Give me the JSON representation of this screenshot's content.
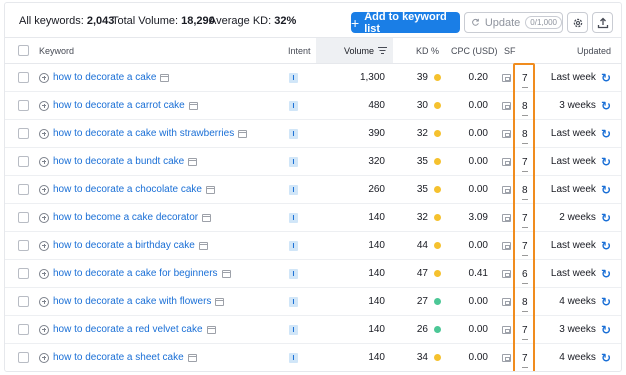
{
  "summary": {
    "all_keywords_label": "All keywords:",
    "all_keywords_value": "2,043",
    "total_volume_label": "Total Volume:",
    "total_volume_value": "18,290",
    "avg_kd_label": "Average KD:",
    "avg_kd_value": "32%"
  },
  "toolbar": {
    "add_label": "Add to keyword list",
    "update_label": "Update",
    "update_count": "0/1,000",
    "settings_icon": "gear-icon",
    "export_icon": "export-icon"
  },
  "columns": {
    "keyword": "Keyword",
    "intent": "Intent",
    "volume": "Volume",
    "kd": "KD %",
    "cpc": "CPC (USD)",
    "sf": "SF",
    "updated": "Updated"
  },
  "colors": {
    "accent": "#1a7ee6",
    "link": "#1a6fd6",
    "kd_yellow": "#f5c12e",
    "kd_green": "#4cc796",
    "highlight": "#f08c1e"
  },
  "rows": [
    {
      "keyword": "how to decorate a cake",
      "intent": "I",
      "volume": "1,300",
      "kd": "39",
      "kd_color": "#f5c12e",
      "cpc": "0.20",
      "sf": "7",
      "updated": "Last week"
    },
    {
      "keyword": "how to decorate a carrot cake",
      "intent": "I",
      "volume": "480",
      "kd": "30",
      "kd_color": "#f5c12e",
      "cpc": "0.00",
      "sf": "8",
      "updated": "3 weeks"
    },
    {
      "keyword": "how to decorate a cake with strawberries",
      "intent": "I",
      "volume": "390",
      "kd": "32",
      "kd_color": "#f5c12e",
      "cpc": "0.00",
      "sf": "8",
      "updated": "Last week"
    },
    {
      "keyword": "how to decorate a bundt cake",
      "intent": "I",
      "volume": "320",
      "kd": "35",
      "kd_color": "#f5c12e",
      "cpc": "0.00",
      "sf": "7",
      "updated": "Last week"
    },
    {
      "keyword": "how to decorate a chocolate cake",
      "intent": "I",
      "volume": "260",
      "kd": "35",
      "kd_color": "#f5c12e",
      "cpc": "0.00",
      "sf": "8",
      "updated": "Last week"
    },
    {
      "keyword": "how to become a cake decorator",
      "intent": "I",
      "volume": "140",
      "kd": "32",
      "kd_color": "#f5c12e",
      "cpc": "3.09",
      "sf": "7",
      "updated": "2 weeks"
    },
    {
      "keyword": "how to decorate a birthday cake",
      "intent": "I",
      "volume": "140",
      "kd": "44",
      "kd_color": "#f5c12e",
      "cpc": "0.00",
      "sf": "7",
      "updated": "Last week"
    },
    {
      "keyword": "how to decorate a cake for beginners",
      "intent": "I",
      "volume": "140",
      "kd": "47",
      "kd_color": "#f5c12e",
      "cpc": "0.41",
      "sf": "6",
      "updated": "Last week"
    },
    {
      "keyword": "how to decorate a cake with flowers",
      "intent": "I",
      "volume": "140",
      "kd": "27",
      "kd_color": "#4cc796",
      "cpc": "0.00",
      "sf": "8",
      "updated": "4 weeks"
    },
    {
      "keyword": "how to decorate a red velvet cake",
      "intent": "I",
      "volume": "140",
      "kd": "26",
      "kd_color": "#4cc796",
      "cpc": "0.00",
      "sf": "7",
      "updated": "3 weeks"
    },
    {
      "keyword": "how to decorate a sheet cake",
      "intent": "I",
      "volume": "140",
      "kd": "34",
      "kd_color": "#f5c12e",
      "cpc": "0.00",
      "sf": "7",
      "updated": "4 weeks"
    }
  ]
}
